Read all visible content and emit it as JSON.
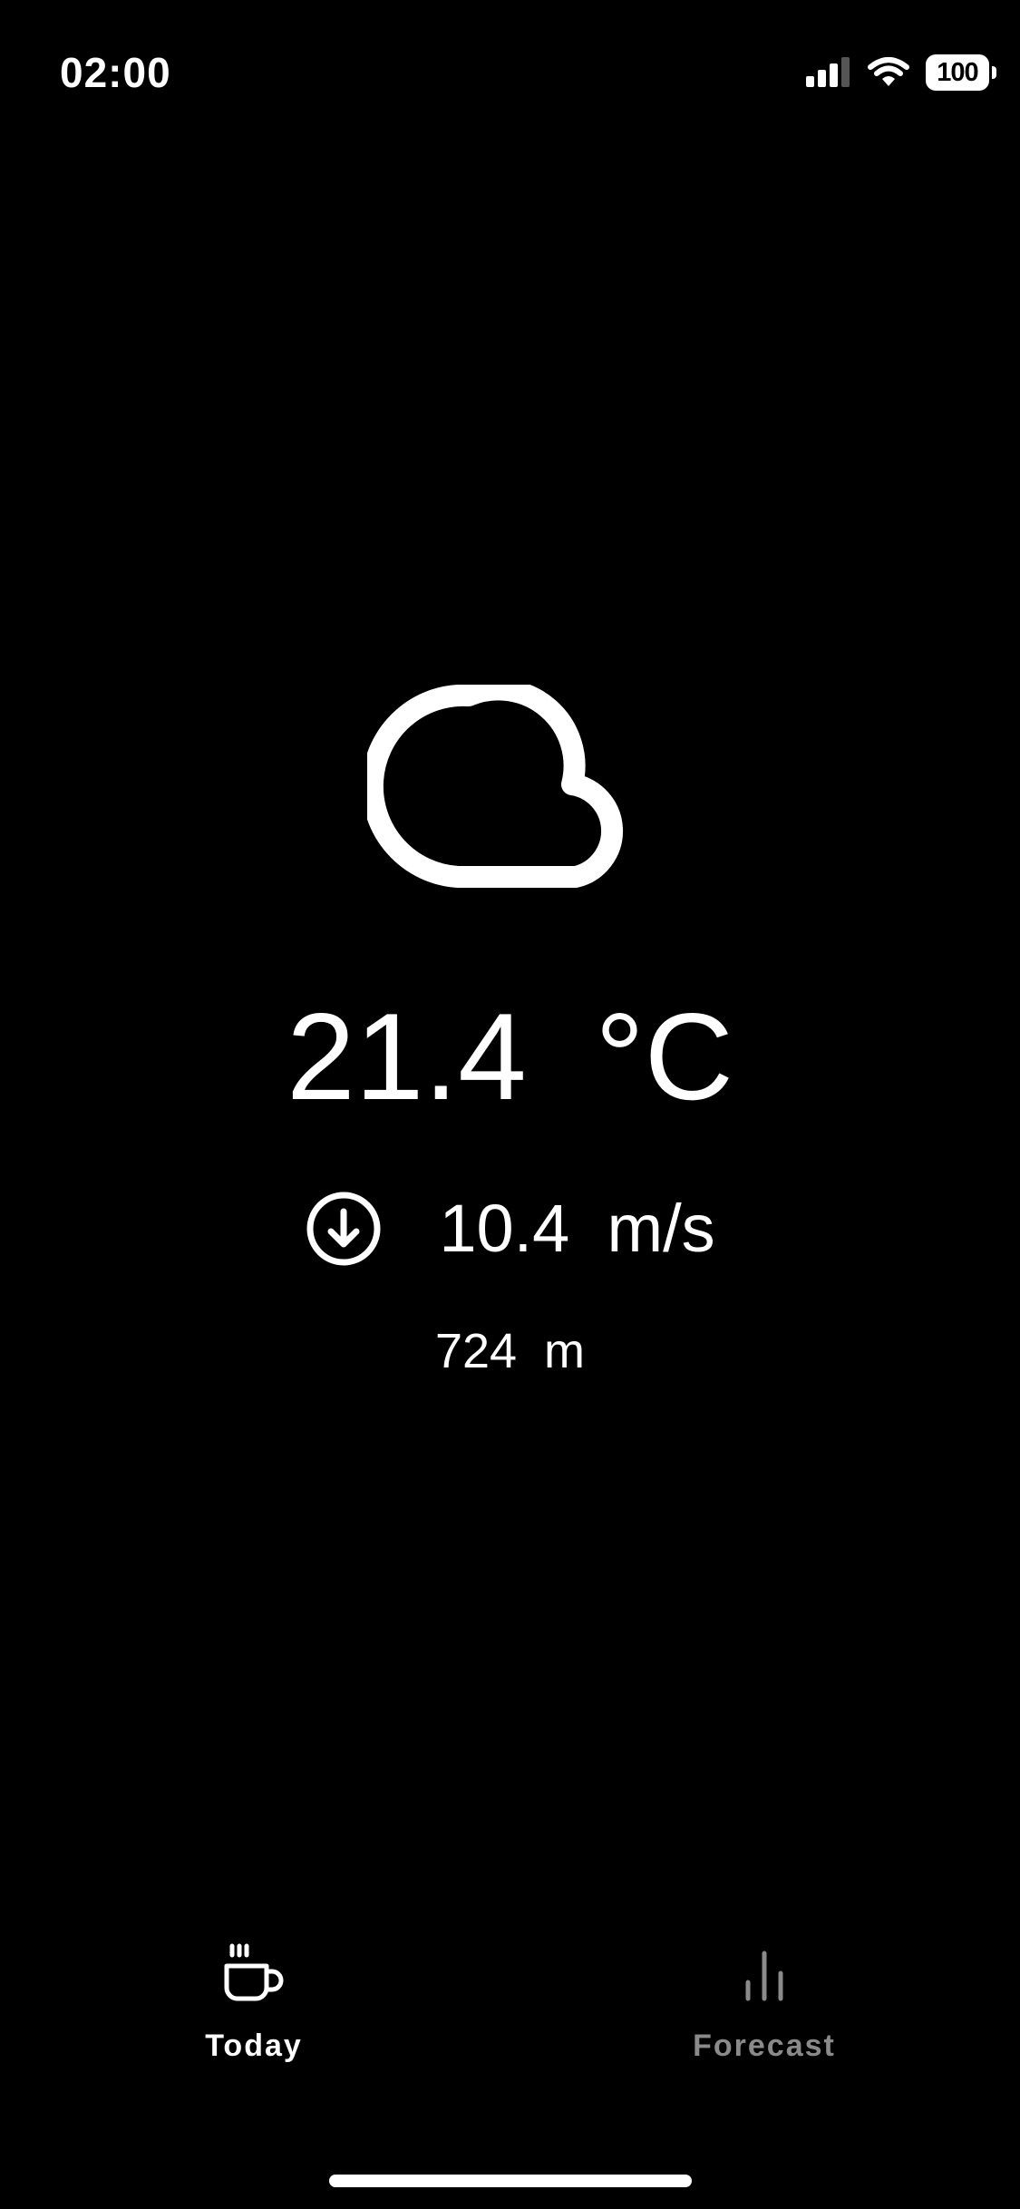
{
  "status_bar": {
    "time": "02:00",
    "battery": "100",
    "icons": [
      "signal-icon",
      "wifi-icon",
      "battery-icon"
    ]
  },
  "weather": {
    "condition_icon": "cloud-icon",
    "temperature": "21.4  °C",
    "wind_direction_icon": "arrow-down-circle-icon",
    "wind_speed": "10.4  m/s",
    "altitude": "724  m"
  },
  "tabs": [
    {
      "label": "Today",
      "icon": "cup-icon",
      "active": true
    },
    {
      "label": "Forecast",
      "icon": "bar-chart-icon",
      "active": false
    }
  ],
  "colors": {
    "background": "#000000",
    "foreground": "#ffffff",
    "inactive": "#8a8a8a"
  }
}
